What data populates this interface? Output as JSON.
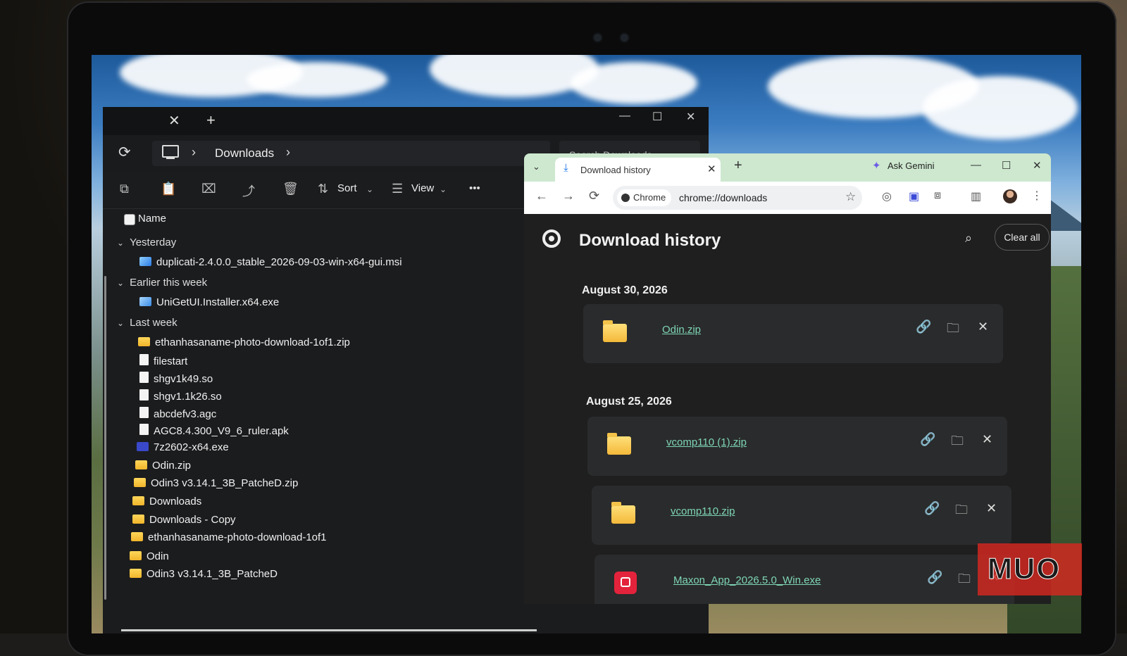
{
  "explorer": {
    "tab_close": "✕",
    "tab_add": "+",
    "window_controls": [
      "—",
      "☐",
      "✕"
    ],
    "breadcrumb": "Downloads",
    "search_placeholder": "Search Downloads",
    "toolbar": {
      "sort_label": "Sort",
      "view_label": "View",
      "more_label": "•••"
    },
    "column_name": "Name",
    "groups": [
      {
        "label": "Yesterday",
        "files": [
          {
            "name": "duplicati-2.4.0.0_stable_2026-09-03-win-x64-gui.msi",
            "icon": "msi"
          }
        ]
      },
      {
        "label": "Earlier this week",
        "files": [
          {
            "name": "UniGetUI.Installer.x64.exe",
            "icon": "exe"
          }
        ]
      },
      {
        "label": "Last week",
        "files": [
          {
            "name": "ethanhasaname-photo-download-1of1.zip",
            "icon": "folder"
          },
          {
            "name": "filestart",
            "icon": "doc"
          },
          {
            "name": "shgv1k49.so",
            "icon": "doc"
          },
          {
            "name": "shgv1.1k26.so",
            "icon": "doc"
          },
          {
            "name": "abcdefv3.agc",
            "icon": "doc"
          },
          {
            "name": "AGC8.4.300_V9_6_ruler.apk",
            "icon": "doc"
          },
          {
            "name": "7z2602-x64.exe",
            "icon": "7zip"
          },
          {
            "name": "Odin.zip",
            "icon": "folder"
          },
          {
            "name": "Odin3 v3.14.1_3B_PatcheD.zip",
            "icon": "folder"
          },
          {
            "name": "Downloads",
            "icon": "folder"
          },
          {
            "name": "Downloads - Copy",
            "icon": "folder"
          },
          {
            "name": "ethanhasaname-photo-download-1of1",
            "icon": "folder"
          },
          {
            "name": "Odin",
            "icon": "folder"
          },
          {
            "name": "Odin3 v3.14.1_3B_PatcheD",
            "icon": "folder"
          }
        ]
      }
    ]
  },
  "chrome": {
    "tab_title": "Download history",
    "tab_close": "✕",
    "new_tab": "+",
    "gemini_label": "Ask Gemini",
    "window_controls": [
      "—",
      "☐",
      "✕"
    ],
    "chip_label": "Chrome",
    "url": "chrome://downloads",
    "page_title": "Download history",
    "clear_all": "Clear all",
    "sections": [
      {
        "date": "August 30, 2026",
        "items": [
          {
            "name": "Odin.zip",
            "icon": "folder-icon"
          }
        ]
      },
      {
        "date": "August 25, 2026",
        "items": [
          {
            "name": "vcomp110 (1).zip",
            "icon": "folder-icon"
          },
          {
            "name": "vcomp110.zip",
            "icon": "folder-icon"
          },
          {
            "name": "Maxon_App_2026.5.0_Win.exe",
            "icon": "maxon-icon"
          }
        ]
      }
    ]
  },
  "watermark": "MUO",
  "colors": {
    "link": "#7ed6b6",
    "chrome_frame": "#cde8cf",
    "explorer_bg": "#1b1c1e",
    "brand": "#d62820"
  }
}
